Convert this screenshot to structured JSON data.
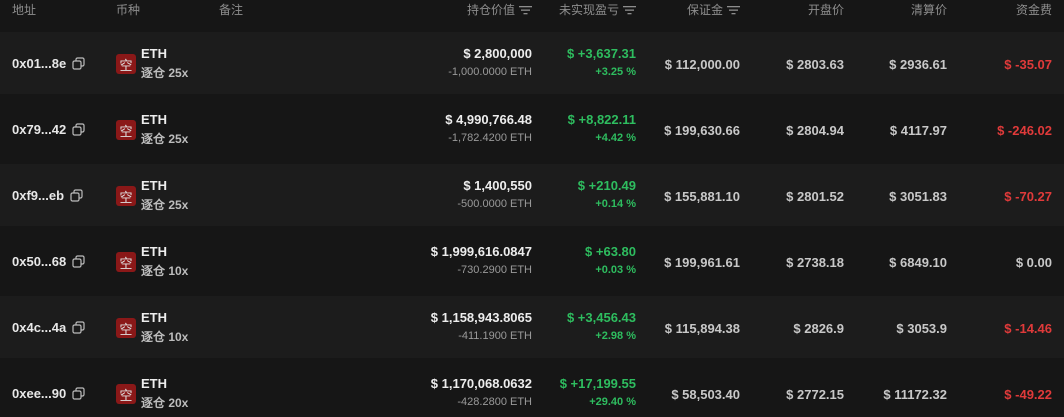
{
  "colors": {
    "background": "#161616",
    "profit_green": "#2ebd5f",
    "loss_red": "#e03a3a",
    "short_badge": "#8a1818"
  },
  "header": {
    "address": "地址",
    "coin": "币种",
    "note": "备注",
    "position_value": "持仓价值",
    "unrealized_pnl": "未实现盈亏",
    "margin": "保证金",
    "entry_price": "开盘价",
    "liq_price": "清算价",
    "funding": "资金费"
  },
  "rows": [
    {
      "address": "0x01...8e",
      "side": "空",
      "coin": "ETH",
      "mode": "逐仓 25x",
      "value": "$ 2,800,000",
      "size": "-1,000.0000 ETH",
      "pnl": "$ +3,637.31",
      "pnl_pct": "+3.25 %",
      "margin": "$ 112,000.00",
      "entry": "$ 2803.63",
      "liq": "$ 2936.61",
      "funding": "$ -35.07"
    },
    {
      "address": "0x79...42",
      "side": "空",
      "coin": "ETH",
      "mode": "逐仓 25x",
      "value": "$ 4,990,766.48",
      "size": "-1,782.4200 ETH",
      "pnl": "$ +8,822.11",
      "pnl_pct": "+4.42 %",
      "margin": "$ 199,630.66",
      "entry": "$ 2804.94",
      "liq": "$ 4117.97",
      "funding": "$ -246.02"
    },
    {
      "address": "0xf9...eb",
      "side": "空",
      "coin": "ETH",
      "mode": "逐仓 25x",
      "value": "$ 1,400,550",
      "size": "-500.0000 ETH",
      "pnl": "$ +210.49",
      "pnl_pct": "+0.14 %",
      "margin": "$ 155,881.10",
      "entry": "$ 2801.52",
      "liq": "$ 3051.83",
      "funding": "$ -70.27"
    },
    {
      "address": "0x50...68",
      "side": "空",
      "coin": "ETH",
      "mode": "逐仓 10x",
      "value": "$ 1,999,616.0847",
      "size": "-730.2900 ETH",
      "pnl": "$ +63.80",
      "pnl_pct": "+0.03 %",
      "margin": "$ 199,961.61",
      "entry": "$ 2738.18",
      "liq": "$ 6849.10",
      "funding": "$ 0.00"
    },
    {
      "address": "0x4c...4a",
      "side": "空",
      "coin": "ETH",
      "mode": "逐仓 10x",
      "value": "$ 1,158,943.8065",
      "size": "-411.1900 ETH",
      "pnl": "$ +3,456.43",
      "pnl_pct": "+2.98 %",
      "margin": "$ 115,894.38",
      "entry": "$ 2826.9",
      "liq": "$ 3053.9",
      "funding": "$ -14.46"
    },
    {
      "address": "0xee...90",
      "side": "空",
      "coin": "ETH",
      "mode": "逐仓 20x",
      "value": "$ 1,170,068.0632",
      "size": "-428.2800 ETH",
      "pnl": "$ +17,199.55",
      "pnl_pct": "+29.40 %",
      "margin": "$ 58,503.40",
      "entry": "$ 2772.15",
      "liq": "$ 11172.32",
      "funding": "$ -49.22"
    }
  ]
}
